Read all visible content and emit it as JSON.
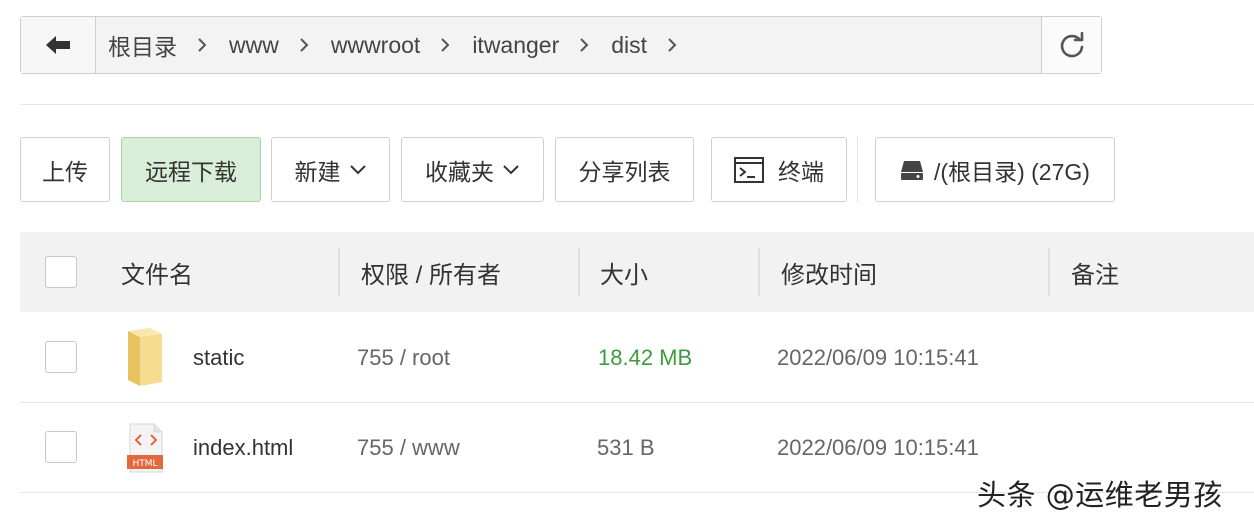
{
  "path": {
    "crumbs": [
      "根目录",
      "www",
      "wwwroot",
      "itwanger",
      "dist"
    ]
  },
  "toolbar": {
    "upload": "上传",
    "remote_download": "远程下载",
    "new": "新建",
    "favorites": "收藏夹",
    "share_list": "分享列表",
    "terminal": "终端",
    "disk": "/(根目录) (27G)"
  },
  "table": {
    "headers": {
      "name": "文件名",
      "perm": "权限 / 所有者",
      "size": "大小",
      "mtime": "修改时间",
      "note": "备注"
    },
    "rows": [
      {
        "name": "static",
        "perm": "755 / root",
        "size": "18.42 MB",
        "mtime": "2022/06/09 10:15:41",
        "type": "folder"
      },
      {
        "name": "index.html",
        "perm": "755 / www",
        "size": "531 B",
        "mtime": "2022/06/09 10:15:41",
        "type": "html-file"
      }
    ]
  },
  "html_icon_label": "HTML",
  "watermark": "头条 @运维老男孩",
  "colors": {
    "accent_green": "#3d9c3d",
    "button_green_bg": "#d9eed9",
    "folder": "#f3d57e",
    "html_badge": "#e2683d"
  }
}
